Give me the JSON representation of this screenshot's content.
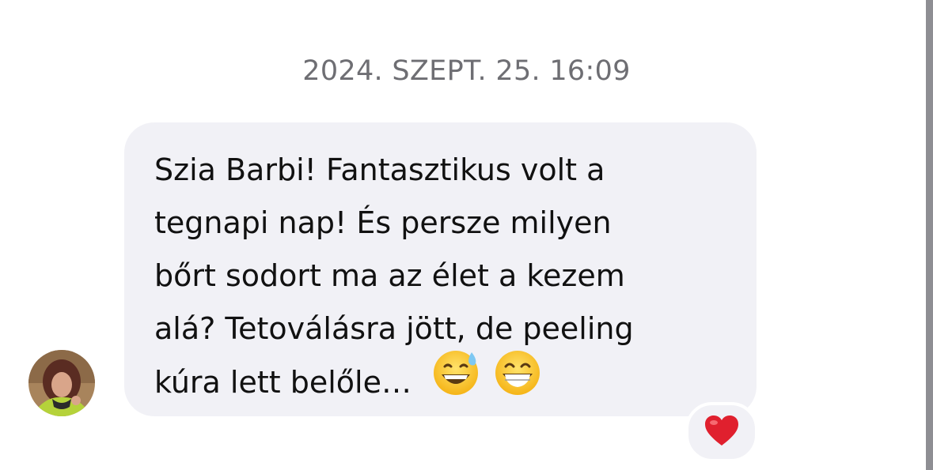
{
  "timestamp": "2024. SZEPT. 25. 16:09",
  "message": {
    "lines": [
      "Szia Barbi! Fantasztikus volt a",
      "tegnapi nap! És persze milyen",
      "bőrt sodort ma az élet a kezem",
      "alá? Tetoválásra jött, de peeling",
      "kúra lett belőle…"
    ],
    "emojis": [
      "grinning-face-with-sweat-icon",
      "beaming-face-icon"
    ]
  },
  "reaction": {
    "icon": "red-heart-icon",
    "color": "#e0202e"
  },
  "colors": {
    "bubble": "#f1f1f6",
    "timestamp_text": "#6e6e73",
    "message_text": "#111111"
  }
}
